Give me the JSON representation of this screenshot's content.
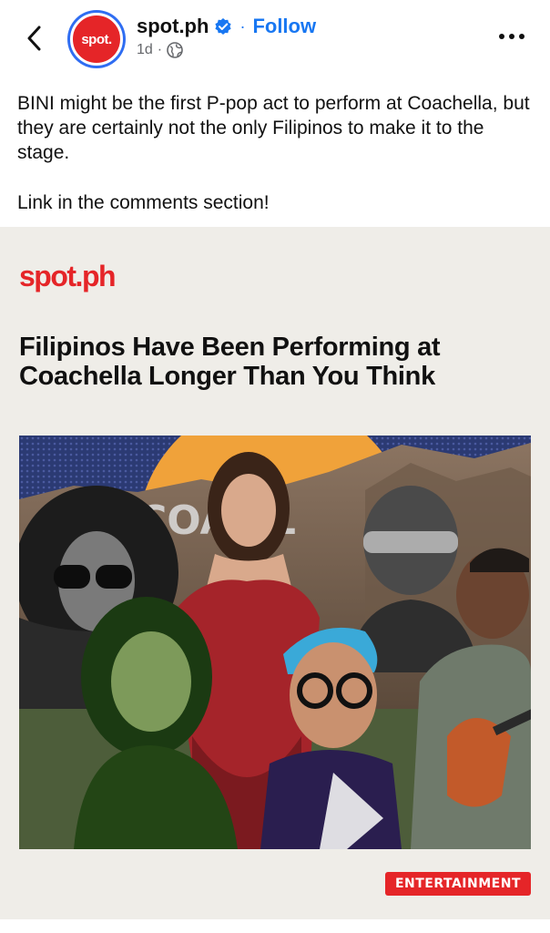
{
  "header": {
    "page_name": "spot.ph",
    "follow_label": "Follow",
    "time": "1d",
    "avatar_text": "spot.",
    "icons": [
      "back-chevron-icon",
      "verified-badge-icon",
      "globe-icon",
      "more-options-icon"
    ]
  },
  "post": {
    "caption_line1": "BINI might be the first P-pop act to perform at Coachella, but they are certainly not the only Filipinos to make it to the stage.",
    "caption_line2": "Link in the comments section!"
  },
  "card": {
    "logo": "spot.ph",
    "title": "Filipinos Have Been Performing at Coachella Longer Than You Think",
    "collage_sign_text": "COA      LL",
    "badge": "ENTERTAINMENT"
  },
  "colors": {
    "brand_red": "#e52528",
    "link_blue": "#1877f2",
    "card_bg": "#efede8"
  }
}
